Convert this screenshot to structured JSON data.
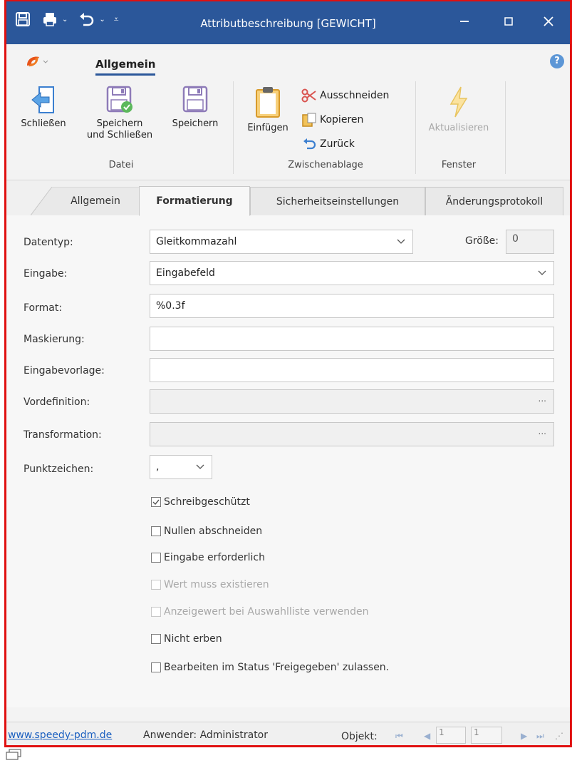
{
  "window": {
    "title": "Attributbeschreibung [GEWICHT]"
  },
  "ribbon": {
    "tab": "Allgemein",
    "groups": {
      "datei": {
        "label": "Datei",
        "close": "Schließen",
        "save_close_1": "Speichern",
        "save_close_2": "und Schließen",
        "save": "Speichern"
      },
      "clipboard": {
        "label": "Zwischenablage",
        "paste": "Einfügen",
        "cut": "Ausschneiden",
        "copy": "Kopieren",
        "undo": "Zurück"
      },
      "fenster": {
        "label": "Fenster",
        "refresh": "Aktualisieren"
      }
    }
  },
  "tabs": [
    "Allgemein",
    "Formatierung",
    "Sicherheitseinstellungen",
    "Änderungsprotokoll"
  ],
  "form": {
    "datentyp": {
      "label": "Datentyp:",
      "value": "Gleitkommazahl"
    },
    "groesse": {
      "label": "Größe:",
      "value": "0"
    },
    "eingabe": {
      "label": "Eingabe:",
      "value": "Eingabefeld"
    },
    "format": {
      "label": "Format:",
      "value": "%0.3f"
    },
    "maskierung": {
      "label": "Maskierung:",
      "value": ""
    },
    "eingabevorlage": {
      "label": "Eingabevorlage:",
      "value": ""
    },
    "vordefinition": {
      "label": "Vordefinition:",
      "value": "",
      "button": "..."
    },
    "transformation": {
      "label": "Transformation:",
      "value": "",
      "button": "..."
    },
    "punktzeichen": {
      "label": "Punktzeichen:",
      "value": ","
    },
    "checkboxes": [
      {
        "label": "Schreibgeschützt",
        "checked": true,
        "enabled": true
      },
      {
        "label": "Nullen abschneiden",
        "checked": false,
        "enabled": true
      },
      {
        "label": "Eingabe erforderlich",
        "checked": false,
        "enabled": true
      },
      {
        "label": "Wert muss existieren",
        "checked": false,
        "enabled": false
      },
      {
        "label": "Anzeigewert bei Auswahlliste verwenden",
        "checked": false,
        "enabled": false
      },
      {
        "label": "Nicht erben",
        "checked": false,
        "enabled": true
      },
      {
        "label": "Bearbeiten im Status 'Freigegeben' zulassen.",
        "checked": false,
        "enabled": true
      }
    ]
  },
  "statusbar": {
    "link": "www.speedy-pdm.de",
    "user": "Anwender: Administrator",
    "objekt_label": "Objekt:",
    "current": "1",
    "total": "1"
  },
  "colors": {
    "titlebar": "#2b579a",
    "frame": "#e01010",
    "link": "#1a5fc0"
  }
}
